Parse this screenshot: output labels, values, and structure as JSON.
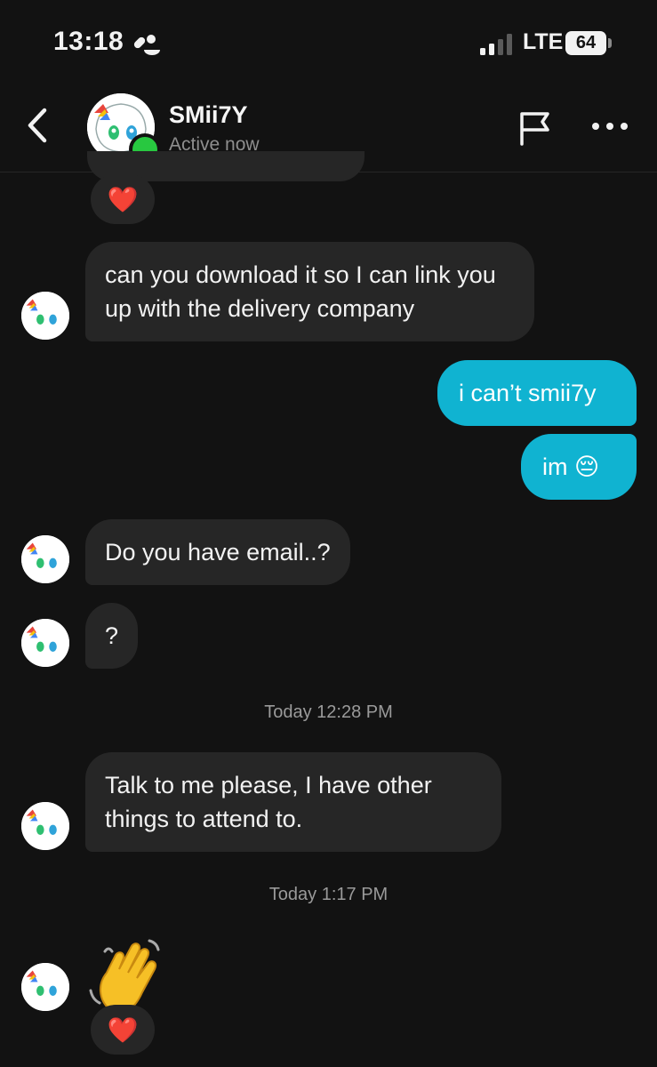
{
  "status_bar": {
    "time": "13:18",
    "network": "LTE",
    "battery": "64"
  },
  "header": {
    "name": "SMii7Y",
    "status": "Active now"
  },
  "messages": {
    "in_1": "can you download it so I can link you up with the delivery company",
    "out_1": "i can’t smii7y",
    "out_2": "im 😔",
    "in_2": "Do you have email..?",
    "in_3": "?",
    "time_1": "Today 12:28 PM",
    "in_4": "Talk to me please, I have other things to attend to.",
    "time_2": "Today 1:17 PM",
    "reaction": "❤️"
  },
  "icons": [
    "back-icon",
    "flag-icon",
    "more-icon",
    "wave-emoji-icon",
    "heart-icon"
  ],
  "colors": {
    "background": "#121212",
    "incoming_bubble": "#262626",
    "outgoing_bubble": "#10b3d1",
    "online": "#28c840"
  }
}
